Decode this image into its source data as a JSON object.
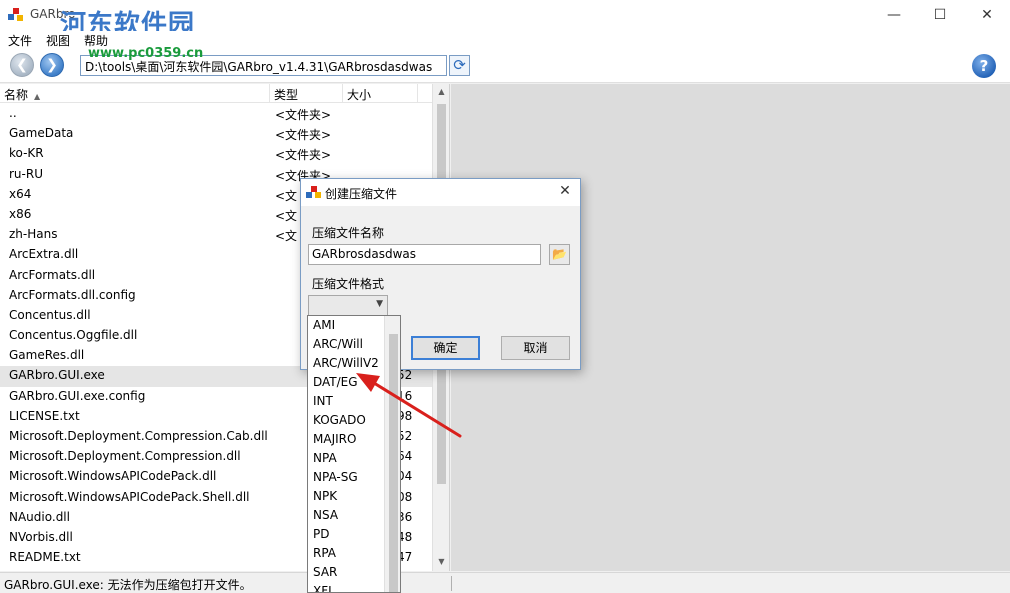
{
  "window": {
    "title": "GARbro",
    "watermark": "河东软件园",
    "watermark_url": "www.pc0359.cn",
    "minimize": "—",
    "maximize": "☐",
    "close": "✕"
  },
  "menu": {
    "items": [
      "文件",
      "视图",
      "帮助"
    ]
  },
  "toolbar": {
    "back": "❮",
    "forward": "❯",
    "path": "D:\\tools\\桌面\\河东软件园\\GARbro_v1.4.31\\GARbrosdasdwas",
    "refresh": "⟳",
    "help": "?"
  },
  "file_list": {
    "columns": {
      "name": "名称",
      "type": "类型",
      "size": "大小"
    },
    "rows": [
      {
        "name": "..",
        "type": "<文件夹>",
        "size": ""
      },
      {
        "name": "GameData",
        "type": "<文件夹>",
        "size": ""
      },
      {
        "name": "ko-KR",
        "type": "<文件夹>",
        "size": ""
      },
      {
        "name": "ru-RU",
        "type": "<文件夹>",
        "size": ""
      },
      {
        "name": "x64",
        "type": "<文",
        "size": ""
      },
      {
        "name": "x86",
        "type": "<文",
        "size": ""
      },
      {
        "name": "zh-Hans",
        "type": "<文",
        "size": ""
      },
      {
        "name": "ArcExtra.dll",
        "type": "",
        "size": ""
      },
      {
        "name": "ArcFormats.dll",
        "type": "",
        "size": ""
      },
      {
        "name": "ArcFormats.dll.config",
        "type": "",
        "size": ""
      },
      {
        "name": "Concentus.dll",
        "type": "",
        "size": ""
      },
      {
        "name": "Concentus.Oggfile.dll",
        "type": "",
        "size": ""
      },
      {
        "name": "GameRes.dll",
        "type": "",
        "size": ""
      },
      {
        "name": "GARbro.GUI.exe",
        "type": "",
        "size": "52"
      },
      {
        "name": "GARbro.GUI.exe.config",
        "type": "",
        "size": "16"
      },
      {
        "name": "LICENSE.txt",
        "type": "",
        "size": "98"
      },
      {
        "name": "Microsoft.Deployment.Compression.Cab.dll",
        "type": "",
        "size": "52"
      },
      {
        "name": "Microsoft.Deployment.Compression.dll",
        "type": "",
        "size": "64"
      },
      {
        "name": "Microsoft.WindowsAPICodePack.dll",
        "type": "",
        "size": "04"
      },
      {
        "name": "Microsoft.WindowsAPICodePack.Shell.dll",
        "type": "",
        "size": "08"
      },
      {
        "name": "NAudio.dll",
        "type": "",
        "size": "36"
      },
      {
        "name": "NVorbis.dll",
        "type": "",
        "size": "48"
      },
      {
        "name": "README.txt",
        "type": "",
        "size": "47"
      }
    ]
  },
  "status": {
    "text": "GARbro.GUI.exe: 无法作为压缩包打开文件。"
  },
  "dialog": {
    "title": "创建压缩文件",
    "close": "✕",
    "name_label": "压缩文件名称",
    "name_value": "GARbrosdasdwas",
    "format_label": "压缩文件格式",
    "format_value": "",
    "ok": "确定",
    "cancel": "取消"
  },
  "format_options": [
    "AMI",
    "ARC/Will",
    "ARC/WillV2",
    "DAT/EG",
    "INT",
    "KOGADO",
    "MAJIRO",
    "NPA",
    "NPA-SG",
    "NPK",
    "NSA",
    "PD",
    "RPA",
    "SAR",
    "XFL"
  ],
  "colors": {
    "accent": "#3c7fd6",
    "arrow": "#d9201c",
    "watermark": "#3b78c8",
    "watermark_url": "#1a9b3c"
  }
}
